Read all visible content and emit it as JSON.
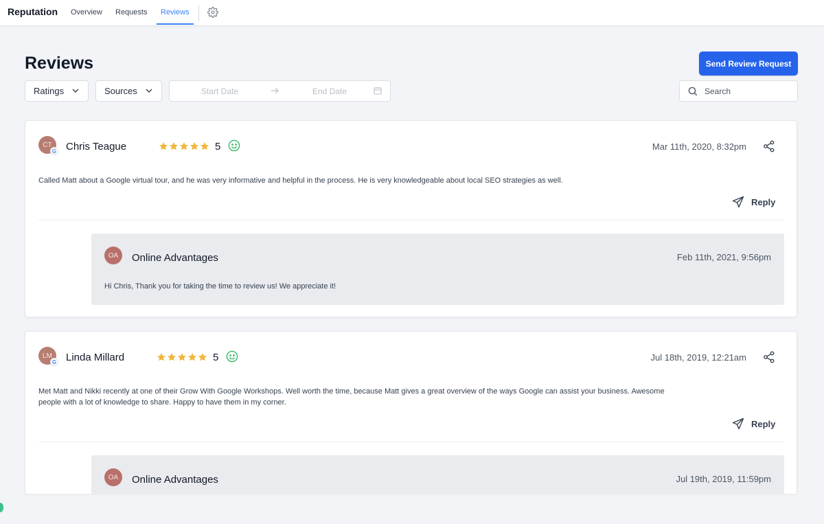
{
  "nav": {
    "brand": "Reputation",
    "tabs": [
      {
        "label": "Overview",
        "active": false
      },
      {
        "label": "Requests",
        "active": false
      },
      {
        "label": "Reviews",
        "active": true
      }
    ],
    "settings_icon": "gear-icon",
    "accent_color": "#3b82f6"
  },
  "header": {
    "title": "Reviews",
    "primary_button": "Send Review Request",
    "primary_color": "#2563eb"
  },
  "filters": {
    "ratings": "Ratings",
    "sources": "Sources",
    "date_start_placeholder": "Start Date",
    "date_end_placeholder": "End Date",
    "search_placeholder": "Search"
  },
  "reviews": [
    {
      "initials": "CT",
      "source_badge": "G",
      "name": "Chris Teague",
      "stars": 5,
      "rating": "5",
      "sentiment": "positive",
      "date": "Mar 11th, 2020, 8:32pm",
      "text": "Called Matt about a Google virtual tour, and he was very informative and helpful in the process. He is very knowledgeable about local SEO strategies as well.",
      "reply_label": "Reply",
      "response": {
        "initials": "OA",
        "name": "Online Advantages",
        "date": "Feb 11th, 2021, 9:56pm",
        "text": "Hi Chris, Thank you for taking the time to review us! We appreciate it!"
      }
    },
    {
      "initials": "LM",
      "source_badge": "G",
      "name": "Linda Millard",
      "stars": 5,
      "rating": "5",
      "sentiment": "positive",
      "date": "Jul 18th, 2019, 12:21am",
      "text_line1": "Met Matt and Nikki recently at one of their Grow With Google Workshops. Well worth the time, because Matt gives a great overview of the ways Google can assist your business. Awesome",
      "text_line2": "people with a lot of knowledge to share. Happy to have them in my corner.",
      "reply_label": "Reply",
      "response": {
        "initials": "OA",
        "name": "Online Advantages",
        "date": "Jul 19th, 2019, 11:59pm"
      }
    }
  ],
  "colors": {
    "star": "#f0b73c",
    "smiley": "#39b86b",
    "avatar": "#b87d72"
  }
}
